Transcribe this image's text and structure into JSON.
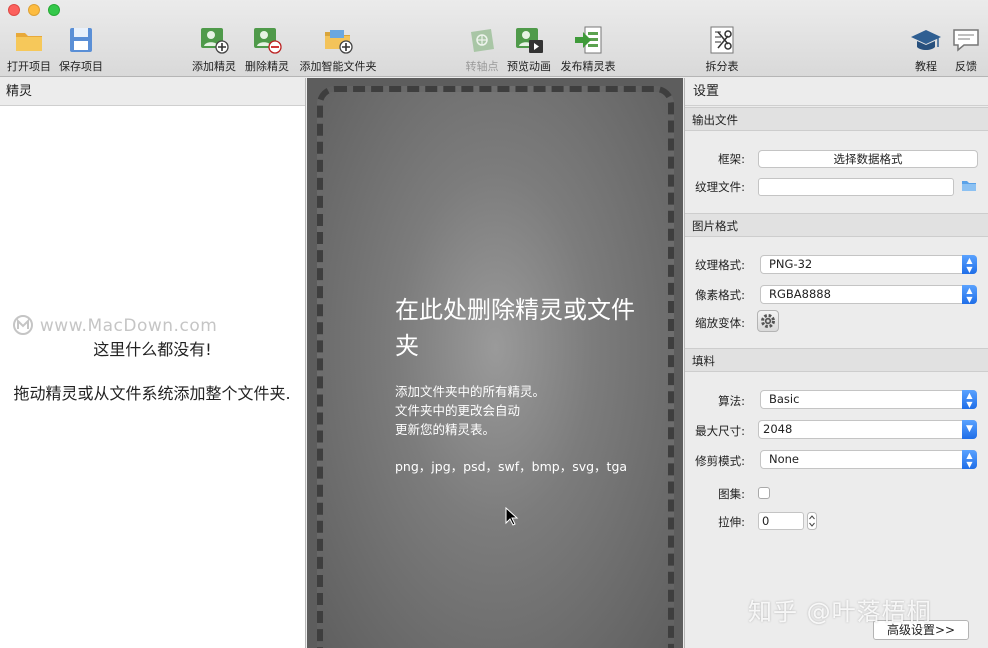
{
  "toolbar": {
    "open_project": "打开项目",
    "save_project": "保存项目",
    "add_sprite": "添加精灵",
    "remove_sprite": "删除精灵",
    "add_smart_folder": "添加智能文件夹",
    "pivot": "转轴点",
    "preview_anim": "预览动画",
    "publish": "发布精灵表",
    "split": "拆分表",
    "tutorial": "教程",
    "feedback": "反馈"
  },
  "left": {
    "header": "精灵",
    "empty_title": "这里什么都没有!",
    "empty_hint": "拖动精灵或从文件系统添加整个文件夹.",
    "watermark": "www.MacDown.com"
  },
  "dropzone": {
    "title": "在此处删除精灵或文件夹",
    "desc1": "添加文件夹中的所有精灵。",
    "desc2": "文件夹中的更改会自动",
    "desc3": "更新您的精灵表。",
    "formats": "png，jpg，psd，swf，bmp，svg，tga"
  },
  "settings": {
    "title": "设置",
    "output_section": "输出文件",
    "framework_label": "框架:",
    "framework_button": "选择数据格式",
    "texture_file_label": "纹理文件:",
    "texture_file_value": "",
    "image_section": "图片格式",
    "texture_format_label": "纹理格式:",
    "texture_format_value": "PNG-32",
    "pixel_format_label": "像素格式:",
    "pixel_format_value": "RGBA8888",
    "scale_variants_label": "缩放变体:",
    "padding_section": "填料",
    "algorithm_label": "算法:",
    "algorithm_value": "Basic",
    "max_size_label": "最大尺寸:",
    "max_size_value": "2048",
    "trim_mode_label": "修剪模式:",
    "trim_mode_value": "None",
    "atlas_label": "图集:",
    "stretch_label": "拉伸:",
    "stretch_value": "0",
    "advanced_button": "高级设置>>"
  },
  "overlay_watermark": "知乎 @叶落梧桐",
  "colors": {
    "accent_blue": "#1f6ee8",
    "dropzone_bg": "#5d5d5d"
  }
}
